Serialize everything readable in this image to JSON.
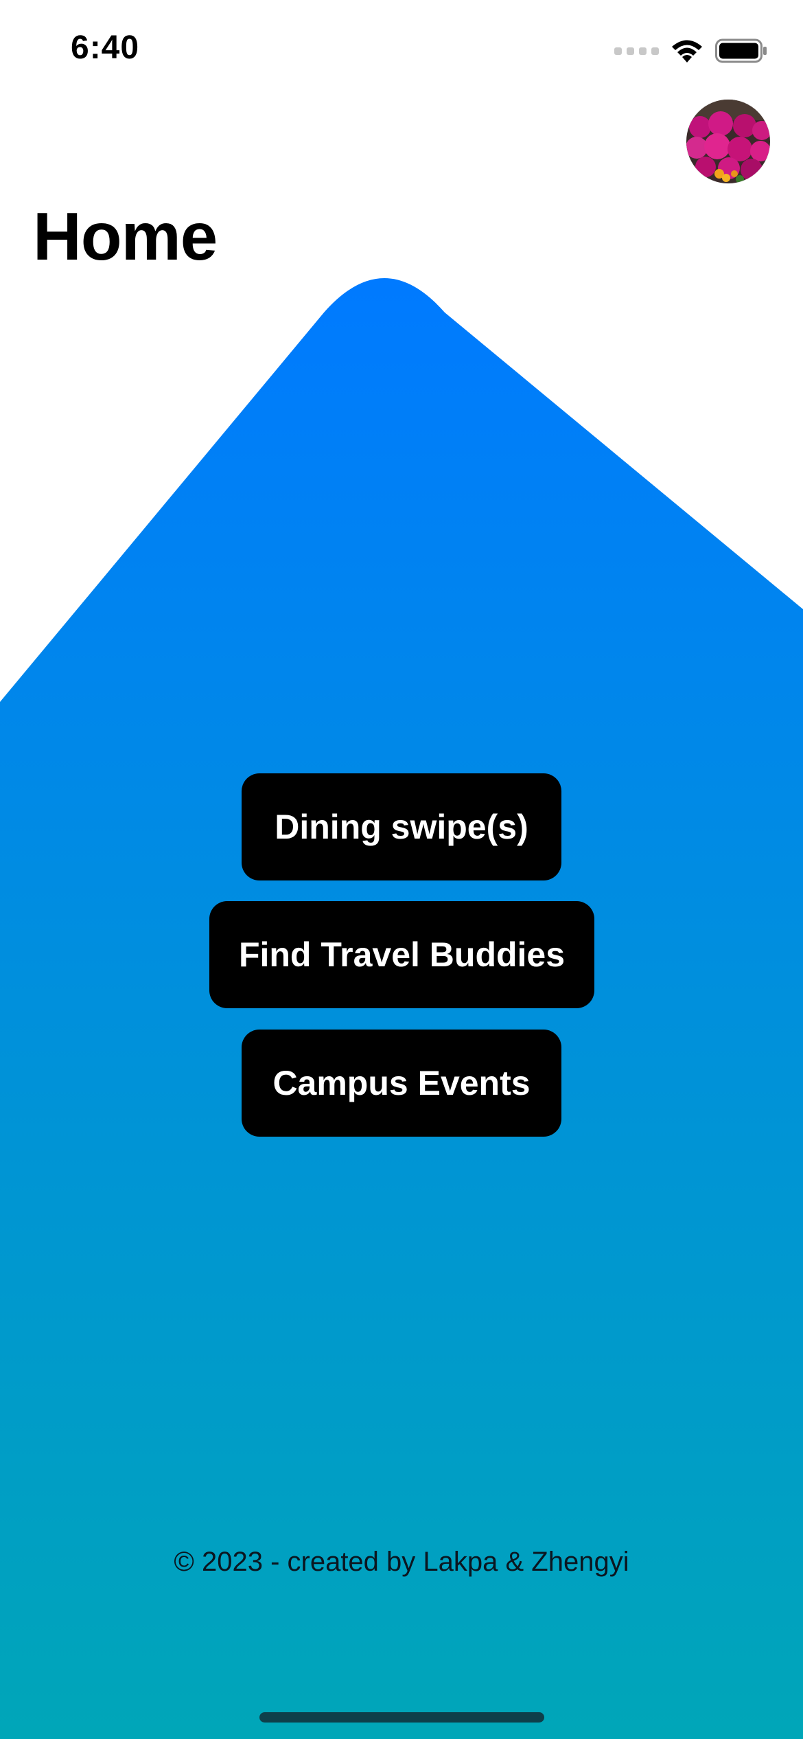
{
  "status_bar": {
    "time": "6:40",
    "icons": [
      "cellular-signal-icon",
      "wifi-icon",
      "battery-icon"
    ]
  },
  "header": {
    "title": "Home",
    "avatar": "profile-avatar"
  },
  "actions": {
    "dining_label": "Dining swipe(s)",
    "travel_label": "Find Travel Buddies",
    "events_label": "Campus Events"
  },
  "footer": {
    "text": "© 2023 - created by Lakpa & Zhengyi"
  },
  "colors": {
    "gradient_top": "#007AFF",
    "gradient_bottom": "#00A6B8",
    "button": "#000000",
    "button_text": "#FFFFFF"
  }
}
